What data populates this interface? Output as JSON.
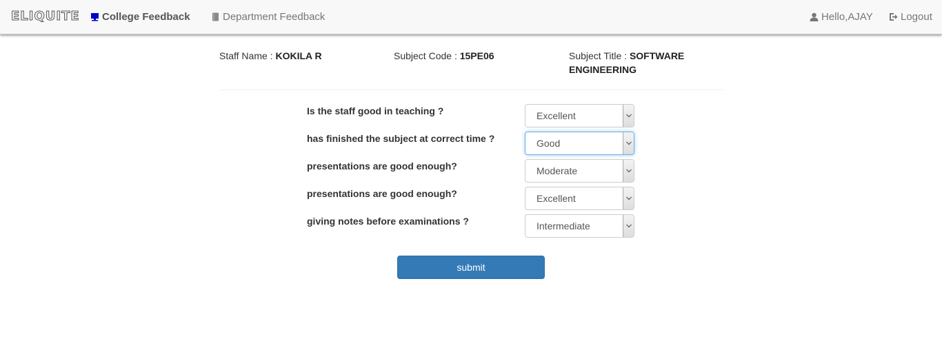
{
  "nav": {
    "brand": "ELIQUITE",
    "college_feedback": "College Feedback",
    "department_feedback": "Department Feedback",
    "hello": "Hello,AJAY",
    "logout": "Logout"
  },
  "info": {
    "staff_label": "Staff Name : ",
    "staff_value": "KOKILA R",
    "code_label": "Subject Code : ",
    "code_value": "15PE06",
    "title_label": "Subject Title : ",
    "title_value": "SOFTWARE ENGINEERING"
  },
  "questions": [
    {
      "text": "Is the staff good in teaching ?",
      "answer": "Excellent"
    },
    {
      "text": "has finished the subject at correct time ?",
      "answer": "Good"
    },
    {
      "text": "presentations are good enough?",
      "answer": "Moderate"
    },
    {
      "text": "presentations are good enough?",
      "answer": "Excellent"
    },
    {
      "text": "giving notes before examinations ?",
      "answer": "Intermediate"
    }
  ],
  "submit_label": "submit"
}
